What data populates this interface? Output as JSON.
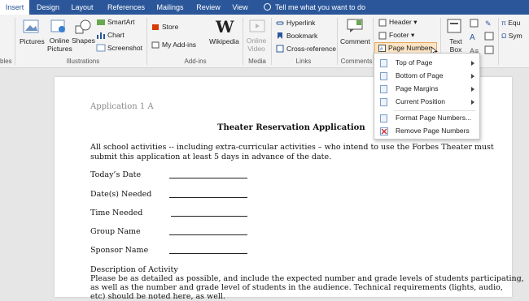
{
  "tabs": [
    "Insert",
    "Design",
    "Layout",
    "References",
    "Mailings",
    "Review",
    "View"
  ],
  "active_tab": "Insert",
  "tell_me": "Tell me what you want to do",
  "ribbon": {
    "tables_label": "bles",
    "illustrations": {
      "pictures": "Pictures",
      "online_pictures": "Online Pictures",
      "shapes": "Shapes",
      "smartart": "SmartArt",
      "chart": "Chart",
      "screenshot": "Screenshot",
      "label": "Illustrations"
    },
    "addins": {
      "store": "Store",
      "my_addins": "My Add-ins",
      "wikipedia": "Wikipedia",
      "label": "Add-ins"
    },
    "media": {
      "online_video": "Online Video",
      "label": "Media"
    },
    "links": {
      "hyperlink": "Hyperlink",
      "bookmark": "Bookmark",
      "cross_reference": "Cross-reference",
      "label": "Links"
    },
    "comments": {
      "comment": "Comment",
      "label": "Comments"
    },
    "header_footer": {
      "header": "Header",
      "footer": "Footer",
      "page_number": "Page Number"
    },
    "text": {
      "text_box": "Text Box"
    },
    "symbols": {
      "equation": "Equ",
      "symbol": "Sym"
    }
  },
  "page_number_menu": [
    {
      "label": "Top of Page",
      "submenu": true
    },
    {
      "label": "Bottom of Page",
      "submenu": true
    },
    {
      "label": "Page Margins",
      "submenu": true
    },
    {
      "label": "Current Position",
      "submenu": true
    },
    {
      "label": "Format Page Numbers...",
      "submenu": false
    },
    {
      "label": "Remove Page Numbers",
      "submenu": false
    }
  ],
  "document": {
    "header": "Application 1 A",
    "title": "Theater Reservation Application",
    "intro_line1": "All school activities -- including extra-curricular activities – who intend to use the Forbes Theater must",
    "intro_line2": "submit this application at least 5 days in advance of the date.",
    "fields": [
      "Today’s Date",
      "Date(s) Needed",
      "Time Needed",
      "Group Name",
      "Sponsor Name"
    ],
    "desc_heading": "Description of Activity",
    "desc_line1": "Please be as detailed as possible, and include the expected number and grade levels of students participating,",
    "desc_line2": "as well as the number and grade level of students in the audience.  Technical requirements (lights, audio,",
    "desc_line3": "etc) should be noted here, as well."
  },
  "colors": {
    "title_bar": "#2b579a",
    "ribbon": "#f3f3f3",
    "highlight": "#fce4c4",
    "highlight_border": "#e8a55a"
  }
}
